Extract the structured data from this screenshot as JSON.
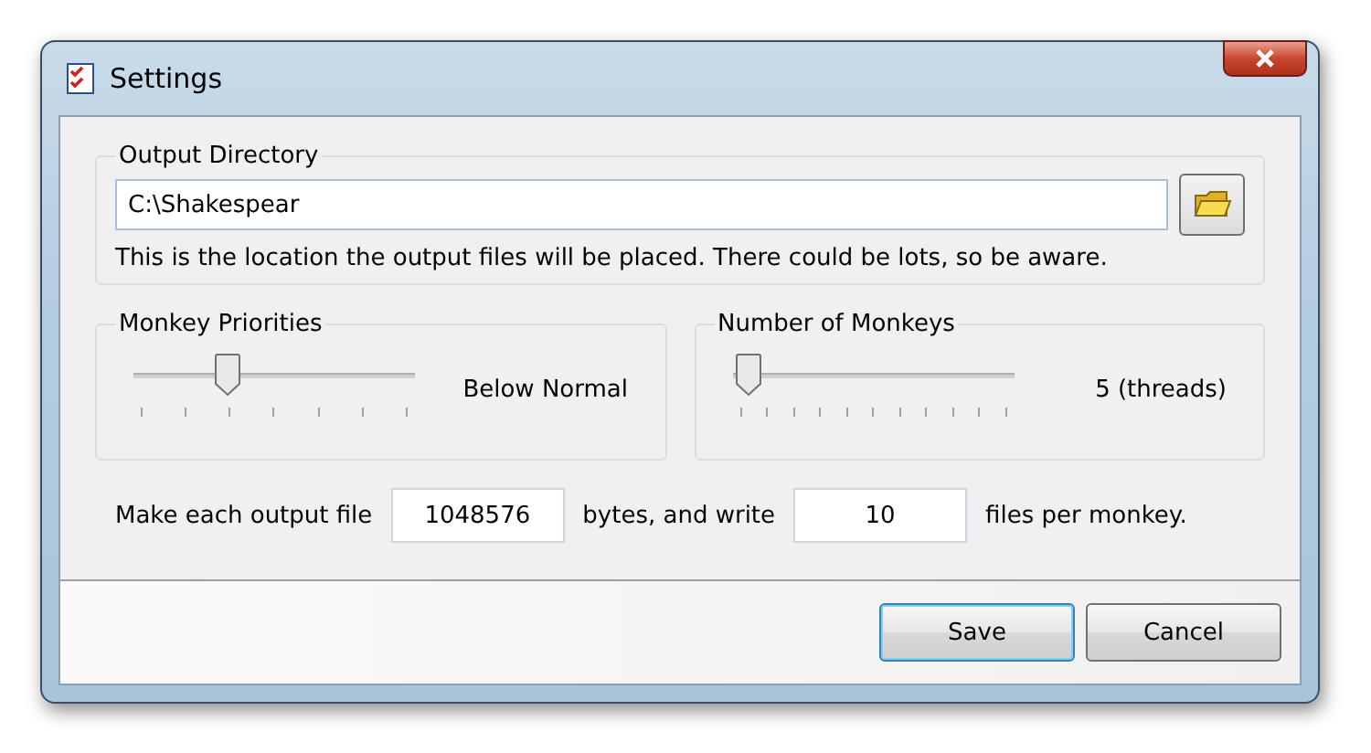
{
  "window": {
    "title": "Settings"
  },
  "output_directory": {
    "legend": "Output Directory",
    "value": "C:\\Shakespear",
    "hint": "This is the location the output files will be placed. There could be lots, so be aware."
  },
  "sliders": [
    {
      "legend": "Monkey Priorities",
      "level": 0.33,
      "reading": "Below Normal"
    },
    {
      "legend": "Number of Monkeys",
      "level": 0.04,
      "reading": "5 (threads)"
    }
  ],
  "size_row": {
    "label_1": "Make each output file",
    "bytes": "1048576",
    "label_2": "bytes, and write",
    "files": "10",
    "label_3": "files per monkey."
  },
  "buttons": [
    {
      "label": "Save",
      "selected": true
    },
    {
      "label": "Cancel",
      "selected": false
    }
  ]
}
